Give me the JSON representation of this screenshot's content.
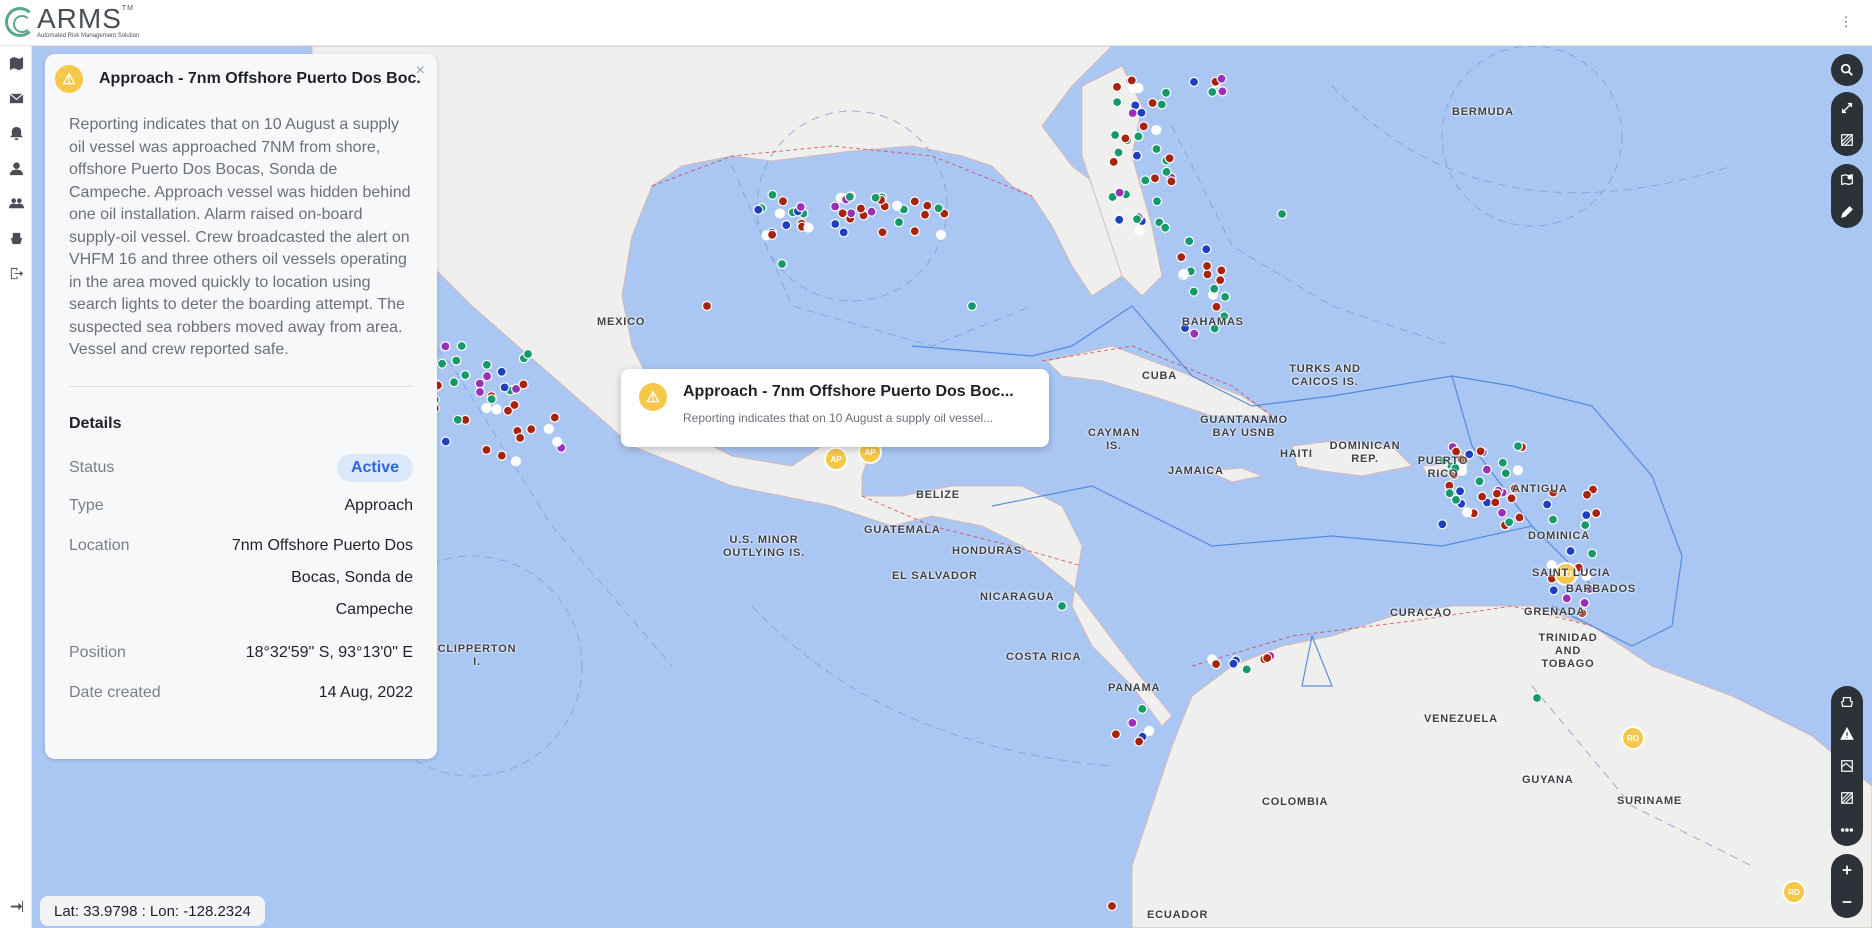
{
  "app": {
    "logo_title": "ARMS",
    "logo_sub": "Automated Risk Management Solution"
  },
  "panel": {
    "title": "Approach - 7nm Offshore Puerto Dos Boc...",
    "description": "Reporting indicates that on 10 August a supply oil vessel was approached 7NM from shore, offshore Puerto Dos Bocas, Sonda de Campeche. Approach vessel was hidden behind one oil installation. Alarm raised on-board supply-oil vessel. Crew broadcasted the alert on VHFM 16 and three others oil vessels operating in the area moved quickly to location using search lights to deter the boarding attempt. The suspected sea robbers moved away from area. Vessel and crew reported safe.",
    "details_title": "Details",
    "rows": {
      "status": {
        "label": "Status",
        "value": "Active"
      },
      "type": {
        "label": "Type",
        "value": "Approach"
      },
      "location": {
        "label": "Location",
        "value": "7nm Offshore Puerto Dos Bocas, Sonda de Campeche"
      },
      "position": {
        "label": "Position",
        "value": "18°32'59\" S, 93°13'0\" E"
      },
      "date": {
        "label": "Date created",
        "value": "14 Aug, 2022"
      }
    }
  },
  "tooltip": {
    "title": "Approach - 7nm Offshore Puerto Dos Boc...",
    "subtitle": "Reporting indicates that on 10 August a supply oil vessel..."
  },
  "coords": "Lat: 33.9798 : Lon: -128.2324",
  "map_labels": [
    {
      "text": "BERMUDA"
    },
    {
      "text": "MEXICO"
    },
    {
      "text": "BAHAMAS"
    },
    {
      "text": "TURKS AND CAICOS IS."
    },
    {
      "text": "CUBA"
    },
    {
      "text": "CAYMAN IS."
    },
    {
      "text": "GUANTANAMO BAY USNB"
    },
    {
      "text": "HAITI"
    },
    {
      "text": "DOMINICAN REP."
    },
    {
      "text": "JAMAICA"
    },
    {
      "text": "PUERTO RICO"
    },
    {
      "text": "ANTIGUA"
    },
    {
      "text": "BELIZE"
    },
    {
      "text": "GUATEMALA"
    },
    {
      "text": "HONDURAS"
    },
    {
      "text": "U.S. MINOR OUTLYING IS."
    },
    {
      "text": "EL SALVADOR"
    },
    {
      "text": "NICARAGUA"
    },
    {
      "text": "DOMINICA"
    },
    {
      "text": "SAINT LUCIA"
    },
    {
      "text": "BARBADOS"
    },
    {
      "text": "GRENADA"
    },
    {
      "text": "CURACAO"
    },
    {
      "text": "TRINIDAD AND TOBAGO"
    },
    {
      "text": "COSTA RICA"
    },
    {
      "text": "CLIPPERTON I."
    },
    {
      "text": "PANAMA"
    },
    {
      "text": "VENEZUELA"
    },
    {
      "text": "GUYANA"
    },
    {
      "text": "SURINAME"
    },
    {
      "text": "COLOMBIA"
    },
    {
      "text": "ECUADOR"
    }
  ],
  "marker_labels": {
    "approach": "AP",
    "robbery": "RO"
  },
  "colors": {
    "red": "#a8230e",
    "green": "#169a6b",
    "blue": "#1f3fbf",
    "purple": "#9a2fb8",
    "white": "#ffffff",
    "yellow": "#f6c84a",
    "water": "#aac6f2",
    "land": "#efefed"
  },
  "icons": {
    "rail": [
      "map-icon",
      "mail-icon",
      "bell-icon",
      "user-icon",
      "group-icon",
      "ship-icon",
      "logout-icon"
    ],
    "tools": [
      "search-icon",
      "expand-icon",
      "hatch-icon",
      "map-pin-icon",
      "pencil-icon",
      "vessel-icon",
      "warning-icon",
      "layers-icon",
      "hatch-icon",
      "more-icon",
      "zoom-in-icon",
      "zoom-out-icon"
    ]
  }
}
